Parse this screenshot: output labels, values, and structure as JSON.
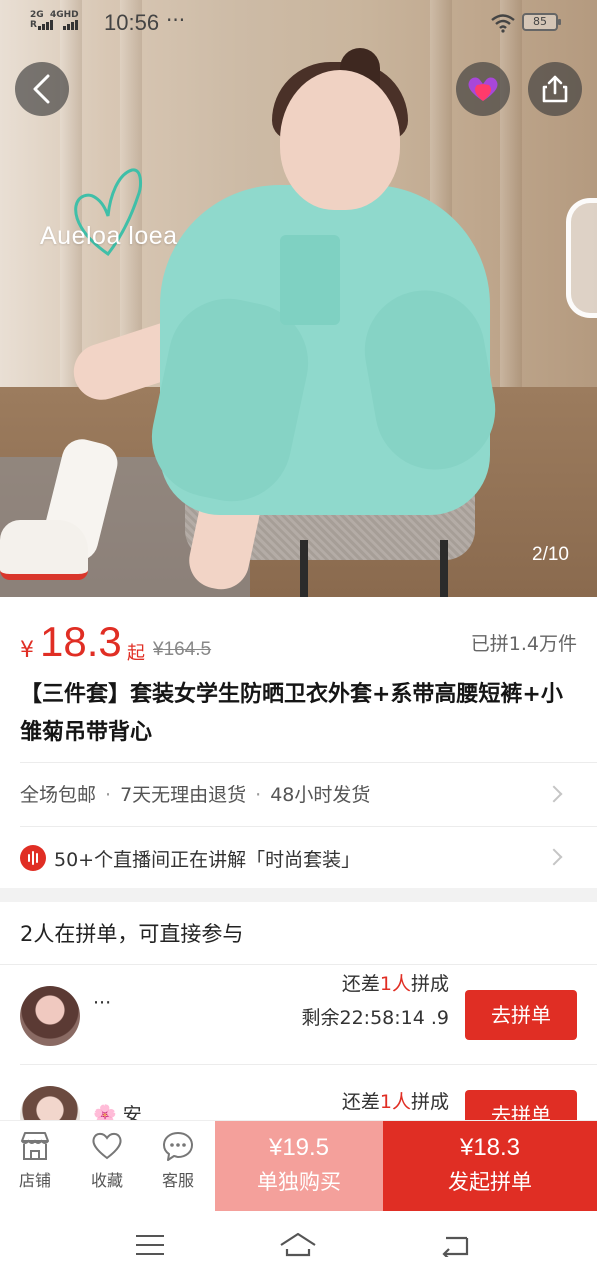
{
  "status_bar": {
    "network_1": "2G",
    "network_2": "4GHD",
    "time": "10:56",
    "more": "···",
    "battery": "85"
  },
  "hero": {
    "brand_logo_text": "Aueloa loea",
    "image_counter": "2/10"
  },
  "product": {
    "currency": "¥",
    "price": "18.3",
    "price_suffix": "起",
    "original_price": "¥164.5",
    "sold": "已拼1.4万件",
    "title": "【三件套】套装女学生防晒卫衣外套+系带高腰短裤+小雏菊吊带背心"
  },
  "services": {
    "items": [
      "全场包邮",
      "7天无理由退货",
      "48小时发货"
    ],
    "separator": "·"
  },
  "live": {
    "text": "50+个直播间正在讲解「时尚套装」"
  },
  "group_buy": {
    "header": "2人在拼单，可直接参与",
    "rows": [
      {
        "username": "···",
        "need_prefix": "还差",
        "need_count": "1人",
        "need_suffix": "拼成",
        "remaining": "剩余22:58:14 .9",
        "button": "去拼单"
      },
      {
        "username": "🌸 安",
        "need_prefix": "还差",
        "need_count": "1人",
        "need_suffix": "拼成",
        "remaining": "",
        "button": "去拼单"
      }
    ]
  },
  "bottom_bar": {
    "store": "店铺",
    "favorite": "收藏",
    "service": "客服",
    "buy_alone_price": "¥19.5",
    "buy_alone_label": "单独购买",
    "buy_group_price": "¥18.3",
    "buy_group_label": "发起拼单"
  },
  "colors": {
    "accent_red": "#e02e24",
    "light_red": "#f4a09b"
  }
}
